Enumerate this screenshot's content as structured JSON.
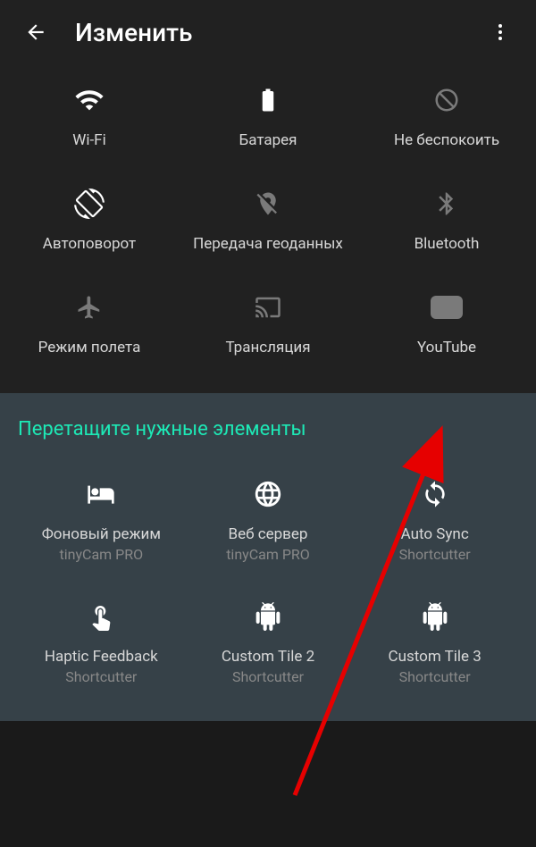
{
  "header": {
    "title": "Изменить"
  },
  "activeTiles": [
    {
      "id": "wifi",
      "label": "Wi-Fi"
    },
    {
      "id": "battery",
      "label": "Батарея"
    },
    {
      "id": "dnd",
      "label": "Не беспокоить"
    },
    {
      "id": "autorotate",
      "label": "Автоповорот"
    },
    {
      "id": "location",
      "label": "Передача геоданных"
    },
    {
      "id": "bluetooth",
      "label": "Bluetooth"
    },
    {
      "id": "airplane",
      "label": "Режим полета"
    },
    {
      "id": "cast",
      "label": "Трансляция"
    },
    {
      "id": "youtube",
      "label": "YouTube"
    }
  ],
  "availableSection": {
    "title": "Перетащите нужные элементы"
  },
  "availableTiles": [
    {
      "id": "bgmode",
      "label": "Фоновый режим",
      "sublabel": "tinyCam PRO"
    },
    {
      "id": "webserver",
      "label": "Веб сервер",
      "sublabel": "tinyCam PRO"
    },
    {
      "id": "autosync",
      "label": "Auto Sync",
      "sublabel": "Shortcutter"
    },
    {
      "id": "haptic",
      "label": "Haptic Feedback",
      "sublabel": "Shortcutter"
    },
    {
      "id": "custom2",
      "label": "Custom Tile 2",
      "sublabel": "Shortcutter"
    },
    {
      "id": "custom3",
      "label": "Custom Tile 3",
      "sublabel": "Shortcutter"
    }
  ]
}
